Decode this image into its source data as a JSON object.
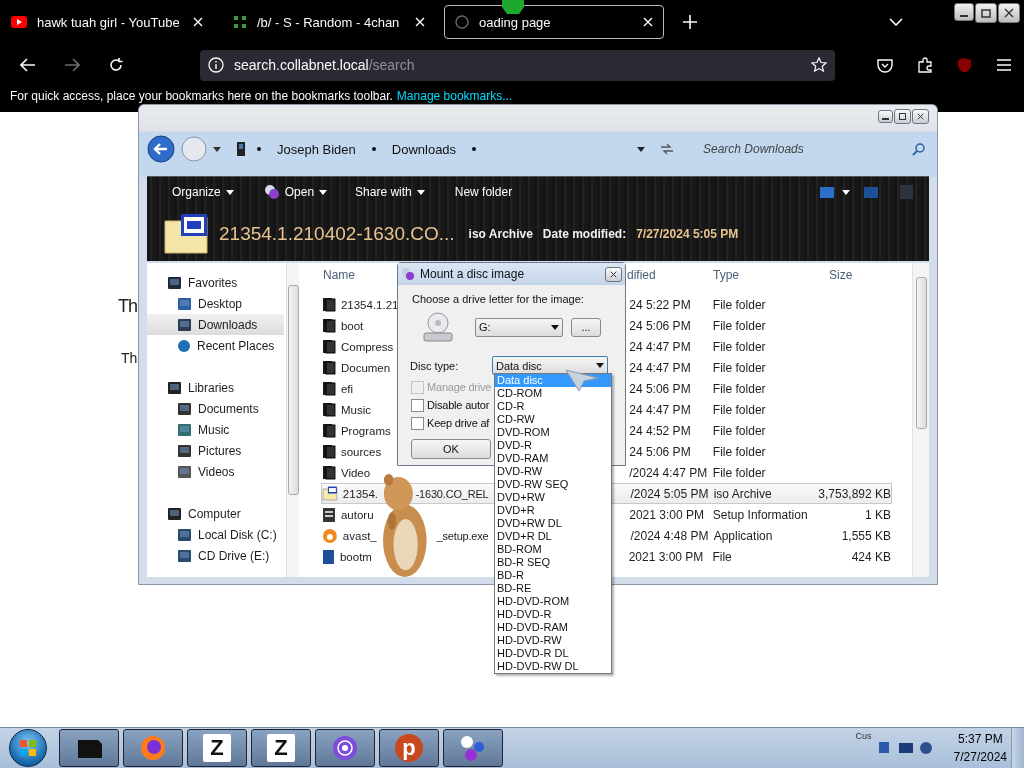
{
  "browser": {
    "tabs": [
      {
        "title": "hawk tuah girl - YouTube",
        "kind": "video",
        "selected": false
      },
      {
        "title": "/b/ - S - Random - 4chan",
        "kind": "board",
        "selected": false
      },
      {
        "title": "oading page",
        "kind": "loading",
        "selected": true
      }
    ],
    "nav_buttons": [
      {
        "kind": "back",
        "disabled": false
      },
      {
        "kind": "forward",
        "disabled": true
      },
      {
        "kind": "reload",
        "disabled": false
      }
    ],
    "url": {
      "host": "search.collabnet.local",
      "path": "/search"
    },
    "bookmarks_bar": {
      "text": "For quick access, place your bookmarks here on the bookmarks toolbar.",
      "link": "Manage bookmarks..."
    }
  },
  "page": {
    "heading": "Th",
    "paragraph": "Th"
  },
  "explorer": {
    "breadcrumb": [
      "Joseph Biden",
      "Downloads"
    ],
    "search_placeholder": "Search Downloads",
    "toolbar": [
      {
        "label": "Organize",
        "kind": "plain",
        "menu": true
      },
      {
        "label": "Open",
        "kind": "open",
        "menu": true
      },
      {
        "label": "Share with",
        "kind": "plain",
        "menu": true
      },
      {
        "label": "New folder",
        "kind": "plain",
        "menu": false
      }
    ],
    "details": {
      "name": "21354.1.210402-1630.CO...",
      "type": "iso Archive",
      "date_label": "Date modified:",
      "date": "7/27/2024 5:05 PM"
    },
    "nav": [
      {
        "label": "Favorites",
        "kind": "star",
        "selected": false,
        "children": [
          {
            "label": "Desktop",
            "kind": "desktop",
            "selected": false
          },
          {
            "label": "Downloads",
            "kind": "downloads",
            "selected": true
          },
          {
            "label": "Recent Places",
            "kind": "recent",
            "selected": false
          }
        ]
      },
      {
        "label": "Libraries",
        "kind": "libraries",
        "selected": false,
        "children": [
          {
            "label": "Documents",
            "kind": "documents",
            "selected": false
          },
          {
            "label": "Music",
            "kind": "music",
            "selected": false
          },
          {
            "label": "Pictures",
            "kind": "pictures",
            "selected": false
          },
          {
            "label": "Videos",
            "kind": "videos",
            "selected": false
          }
        ]
      },
      {
        "label": "Computer",
        "kind": "computer",
        "selected": false,
        "children": [
          {
            "label": "Local Disk (C:)",
            "kind": "disk",
            "selected": false
          },
          {
            "label": "CD Drive (E:)",
            "kind": "disk",
            "selected": false
          }
        ]
      }
    ],
    "columns": [
      "Name",
      "dified",
      "Type",
      "Size"
    ],
    "files": [
      {
        "name": "21354.1.21",
        "kind": "folder",
        "modified": "24 5:22 PM",
        "type": "File folder",
        "selected": false
      },
      {
        "name": "boot",
        "kind": "folder",
        "modified": "24 5:06 PM",
        "type": "File folder",
        "selected": false
      },
      {
        "name": "Compress",
        "kind": "folder",
        "modified": "24 4:47 PM",
        "type": "File folder",
        "selected": false
      },
      {
        "name": "Documen",
        "kind": "folder",
        "modified": "24 4:47 PM",
        "type": "File folder",
        "selected": false
      },
      {
        "name": "efi",
        "kind": "folder",
        "modified": "24 5:06 PM",
        "type": "File folder",
        "selected": false
      },
      {
        "name": "Music",
        "kind": "folder",
        "modified": "24 4:47 PM",
        "type": "File folder",
        "selected": false
      },
      {
        "name": "Programs",
        "kind": "folder",
        "modified": "24 4:52 PM",
        "type": "File folder",
        "selected": false
      },
      {
        "name": "sources",
        "kind": "folder",
        "modified": "24 5:06 PM",
        "type": "File folder",
        "selected": false
      },
      {
        "name": "Video",
        "kind": "folder",
        "modified": "/2024 4:47 PM",
        "type": "File folder",
        "selected": false
      },
      {
        "name": "21354.",
        "name_tail": "-1630.CO_REL",
        "kind": "iso",
        "modified": "/2024 5:05 PM",
        "type": "iso Archive",
        "size": "3,753,892 KB",
        "selected": true
      },
      {
        "name": "autoru",
        "kind": "setup",
        "modified": "2021 3:00 PM",
        "type": "Setup Information",
        "size": "1 KB",
        "selected": false
      },
      {
        "name": "avast_",
        "name_tail": "_setup.exe",
        "kind": "app",
        "modified": "/2024 4:48 PM",
        "type": "Application",
        "size": "1,555 KB",
        "selected": false
      },
      {
        "name": "bootm",
        "kind": "file",
        "modified": "2021 3:00 PM",
        "type": "File",
        "size": "424 KB",
        "selected": false
      }
    ]
  },
  "dialog": {
    "title": "Mount a disc image",
    "prompt": "Choose a drive letter for the image:",
    "drive": "G:",
    "browse": "...",
    "disc_type_label": "Disc type:",
    "disc_type": "Data disc",
    "checkboxes": [
      {
        "label": "Manage drive",
        "checked": false,
        "disabled": true
      },
      {
        "label": "Disable autor",
        "checked": false,
        "disabled": false
      },
      {
        "label": "Keep drive af",
        "checked": false,
        "disabled": false
      }
    ],
    "ok": "OK",
    "options": [
      {
        "label": "Data disc",
        "selected": true
      },
      {
        "label": "CD-ROM",
        "selected": false
      },
      {
        "label": "CD-R",
        "selected": false
      },
      {
        "label": "CD-RW",
        "selected": false
      },
      {
        "label": "DVD-ROM",
        "selected": false
      },
      {
        "label": "DVD-R",
        "selected": false
      },
      {
        "label": "DVD-RAM",
        "selected": false
      },
      {
        "label": "DVD-RW",
        "selected": false
      },
      {
        "label": "DVD-RW SEQ",
        "selected": false
      },
      {
        "label": "DVD+RW",
        "selected": false
      },
      {
        "label": "DVD+R",
        "selected": false
      },
      {
        "label": "DVD+RW DL",
        "selected": false
      },
      {
        "label": "DVD+R DL",
        "selected": false
      },
      {
        "label": "BD-ROM",
        "selected": false
      },
      {
        "label": "BD-R SEQ",
        "selected": false
      },
      {
        "label": "BD-R",
        "selected": false
      },
      {
        "label": "BD-RE",
        "selected": false
      },
      {
        "label": "HD-DVD-ROM",
        "selected": false
      },
      {
        "label": "HD-DVD-R",
        "selected": false
      },
      {
        "label": "HD-DVD-RAM",
        "selected": false
      },
      {
        "label": "HD-DVD-RW",
        "selected": false
      },
      {
        "label": "HD-DVD-R DL",
        "selected": false
      },
      {
        "label": "HD-DVD-RW DL",
        "selected": false
      }
    ]
  },
  "taskbar": {
    "items": [
      {
        "kind": "box"
      },
      {
        "kind": "firefox"
      },
      {
        "kind": "zapp",
        "glyph": "Z"
      },
      {
        "kind": "zapp",
        "glyph": "Z"
      },
      {
        "kind": "tor"
      },
      {
        "kind": "psiphon",
        "glyph": "p"
      },
      {
        "kind": "molecule"
      }
    ],
    "tray_text": "Cus",
    "time": "5:37 PM",
    "date": "7/27/2024"
  }
}
